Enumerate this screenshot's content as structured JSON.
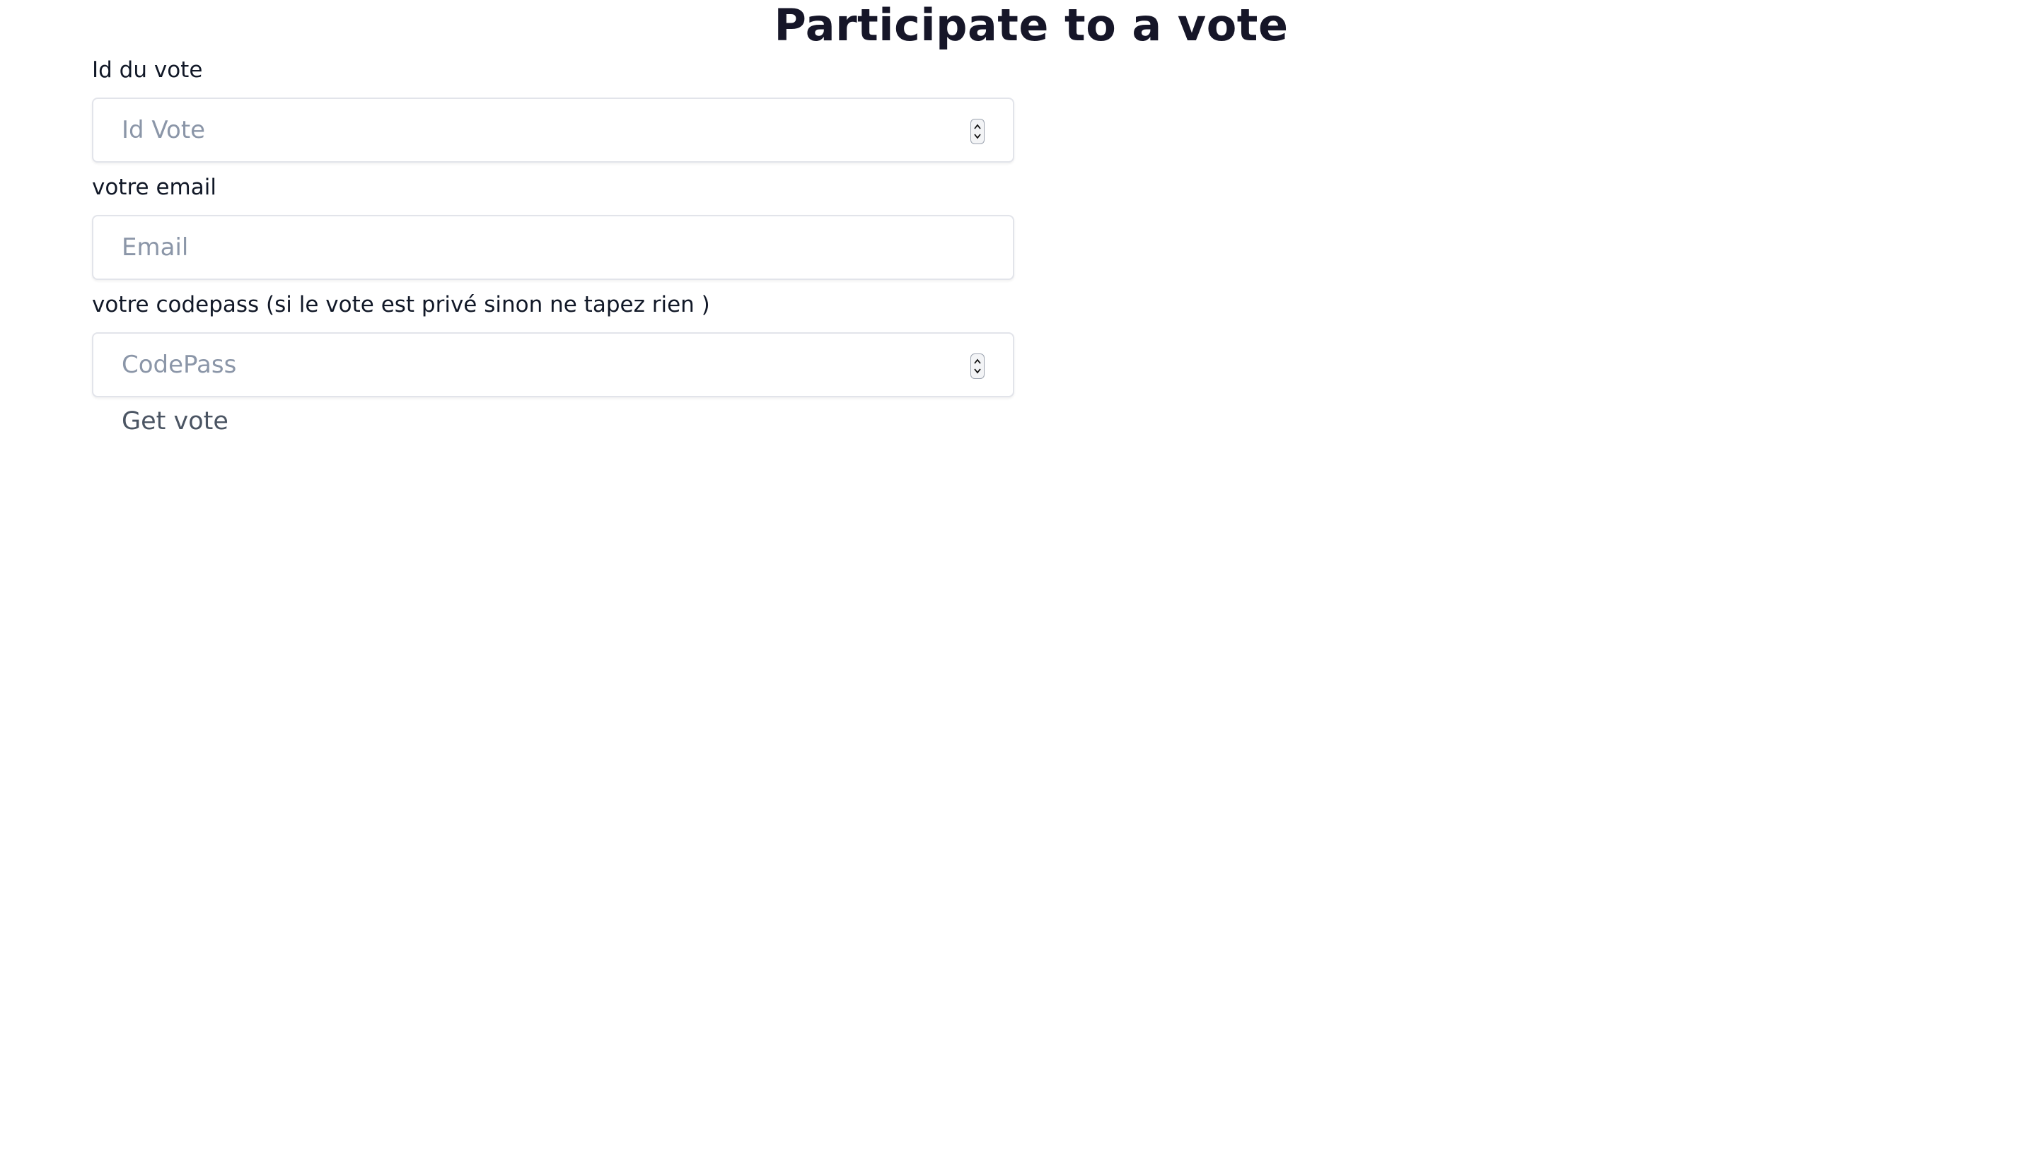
{
  "page": {
    "title": "Participate to a vote"
  },
  "form": {
    "vote_id": {
      "label": "Id du vote",
      "placeholder": "Id Vote",
      "value": ""
    },
    "email": {
      "label": "votre email",
      "placeholder": "Email",
      "value": ""
    },
    "codepass": {
      "label": "votre codepass (si le vote est privé sinon ne tapez rien )",
      "placeholder": "CodePass",
      "value": ""
    },
    "submit_label": "Get vote"
  },
  "icons": {
    "number_spinner": "spinner-up-down-icon"
  },
  "colors": {
    "title": "#161628",
    "label": "#111827",
    "placeholder": "#8b96a8",
    "input_border": "#e2e4ea",
    "button_text": "#4b5563",
    "background": "#ffffff"
  }
}
